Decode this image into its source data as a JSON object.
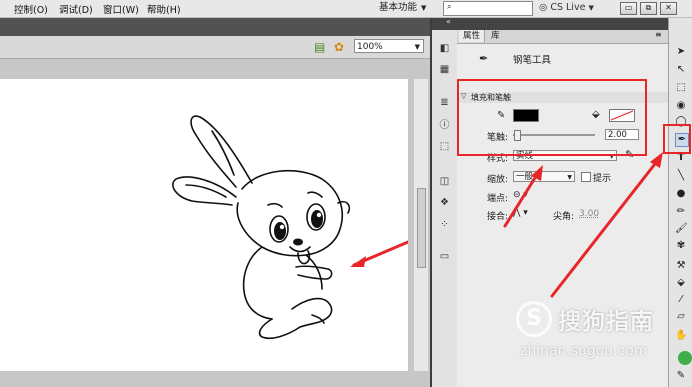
{
  "menu": {
    "control": "控制(O)",
    "debug": "调试(D)",
    "window": "窗口(W)",
    "help": "帮助(H)",
    "workspace": "基本功能",
    "cs_live": "CS Live"
  },
  "stage": {
    "zoom": "100%"
  },
  "properties_panel": {
    "tab_properties": "属性",
    "tab_library": "库",
    "tool_name": "钢笔工具",
    "section_fill_stroke": "填充和笔触",
    "stroke_label": "笔触:",
    "stroke_value": "2.00",
    "style_label": "样式:",
    "style_value": "实线",
    "scale_label": "缩放:",
    "scale_value": "一般",
    "hint_label": "提示",
    "cap_label": "端点:",
    "join_label": "接合:",
    "miter_label": "尖角:",
    "miter_value": "3.00"
  },
  "watermark": {
    "icon": "S",
    "text": "搜狗指南",
    "url": "zhinan.sogou.com"
  },
  "colors": {
    "highlight": "#e8262a",
    "stroke_color": "#000000",
    "fill_color": "none"
  }
}
